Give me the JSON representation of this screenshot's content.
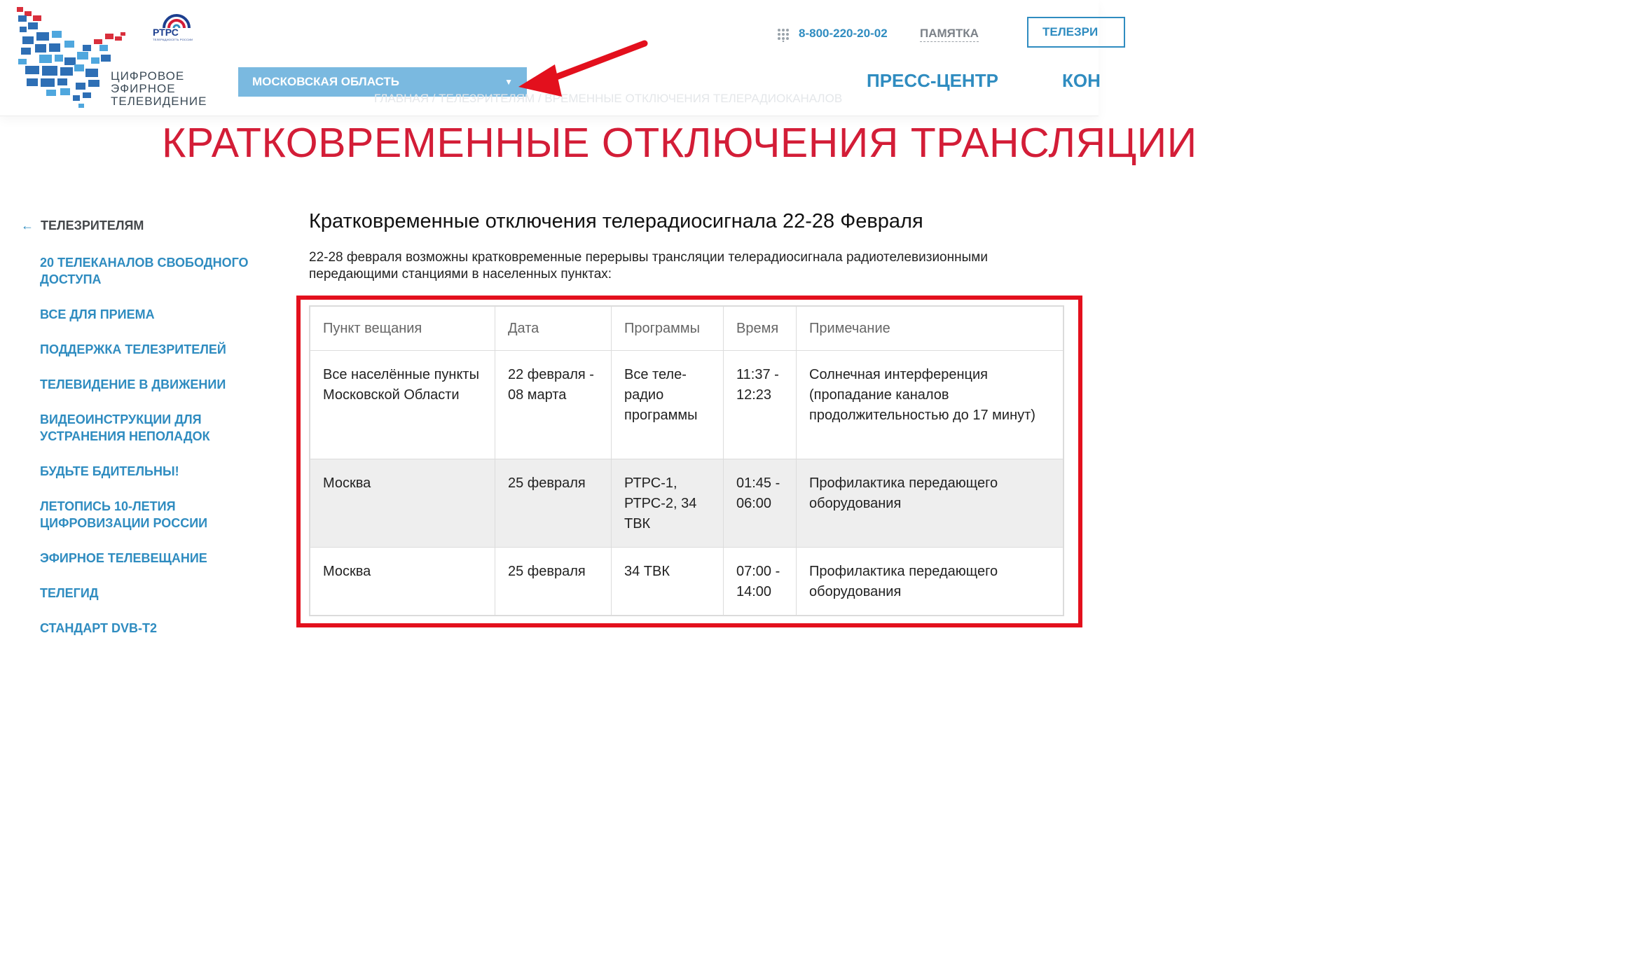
{
  "header": {
    "logo_text": [
      "ЦИФРОВОЕ",
      "ЭФИРНОЕ",
      "ТЕЛЕВИДЕНИЕ"
    ],
    "rtrs_label": "РТРС",
    "rtrs_subtitle": "ТЕЛЕРАДИОСЕТЬ РОССИИ",
    "region_label": "МОСКОВСКАЯ ОБЛАСТЬ",
    "phone": "8-800-220-20-02",
    "memo_link": "ПАМЯТКА",
    "tv_button": "ТЕЛЕЗРИ",
    "nav": [
      "ПРЕСС-ЦЕНТР",
      "КОН"
    ],
    "breadcrumb": "ГЛАВНАЯ / ТЕЛЕЗРИТЕЛЯМ / ВРЕМЕННЫЕ ОТКЛЮЧЕНИЯ ТЕЛЕРАДИОКАНАЛОВ"
  },
  "page_title": "КРАТКОВРЕМЕННЫЕ ОТКЛЮЧЕНИЯ ТРАНСЛЯЦИИ",
  "sidebar": {
    "back_label": "ТЕЛЕЗРИТЕЛЯМ",
    "items": [
      "20 ТЕЛЕКАНАЛОВ СВОБОДНОГО ДОСТУПА",
      "ВСЕ ДЛЯ ПРИЕМА",
      "ПОДДЕРЖКА ТЕЛЕЗРИТЕЛЕЙ",
      "ТЕЛЕВИДЕНИЕ В ДВИЖЕНИИ",
      "ВИДЕОИНСТРУКЦИИ ДЛЯ УСТРАНЕНИЯ НЕПОЛАДОК",
      "БУДЬТЕ БДИТЕЛЬНЫ!",
      "ЛЕТОПИСЬ 10-ЛЕТИЯ ЦИФРОВИЗАЦИИ РОССИИ",
      "ЭФИРНОЕ ТЕЛЕВЕЩАНИЕ",
      "ТЕЛЕГИД",
      "СТАНДАРТ DVB-T2"
    ]
  },
  "content": {
    "heading": "Кратковременные отключения телерадиосигнала 22-28 Февраля",
    "intro": "22-28 февраля возможны кратковременные перерывы трансляции телерадиосигнала радиотелевизионными передающими станциями в населенных пунктах:",
    "table": {
      "headers": [
        "Пункт вещания",
        "Дата",
        "Программы",
        "Время",
        "Примечание"
      ],
      "rows": [
        [
          "Все населённые пункты Московской Области",
          "22 февраля - 08 марта",
          "Все теле- радио программы",
          "11:37 - 12:23",
          "Солнечная интерференция (пропадание каналов продолжительностью до 17 минут)"
        ],
        [
          "Москва",
          "25 февраля",
          "РТРС-1, РТРС-2, 34 ТВК",
          "01:45 - 06:00",
          "Профилактика передающего оборудования"
        ],
        [
          "Москва",
          "25 февраля",
          "34 ТВК",
          "07:00 - 14:00",
          "Профилактика передающего оборудования"
        ]
      ]
    }
  },
  "colors": {
    "accent_blue": "#2f8cc0",
    "region_bg": "#7ab9e0",
    "title_red": "#d31d37",
    "annotation_red": "#e3101d"
  }
}
